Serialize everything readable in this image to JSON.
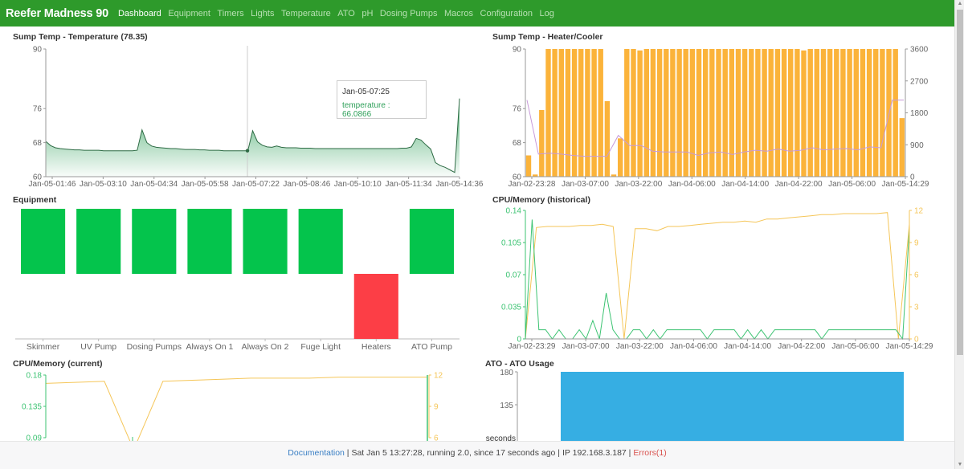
{
  "app": {
    "title": "Reefer Madness 90",
    "nav": [
      {
        "label": "Dashboard",
        "active": true
      },
      {
        "label": "Equipment"
      },
      {
        "label": "Timers"
      },
      {
        "label": "Lights"
      },
      {
        "label": "Temperature"
      },
      {
        "label": "ATO"
      },
      {
        "label": "pH"
      },
      {
        "label": "Dosing Pumps"
      },
      {
        "label": "Macros"
      },
      {
        "label": "Configuration"
      },
      {
        "label": "Log"
      }
    ]
  },
  "colors": {
    "nav_bg": "#2e9a2b",
    "temp_green": "#2fa05a",
    "heater_bar": "#fbb33a",
    "equipment_on": "#04c44c",
    "equipment_off": "#fc3e46",
    "cpu_line": "#3cc372",
    "mem_line": "#f5c659",
    "ato_bar": "#36aee3"
  },
  "panels": {
    "temp": {
      "title": "Sump Temp - Temperature (78.35)"
    },
    "heater": {
      "title": "Sump Temp - Heater/Cooler"
    },
    "equipment": {
      "title": "Equipment"
    },
    "cpu_hist": {
      "title": "CPU/Memory (historical)"
    },
    "cpu_cur": {
      "title": "CPU/Memory (current)"
    },
    "ato": {
      "title": "ATO - ATO Usage"
    }
  },
  "tooltip": {
    "time": "Jan-05-07:25",
    "label": "temperature : 66.0866"
  },
  "footer": {
    "doc_link": "Documentation",
    "sep1": " | ",
    "status": "Sat Jan 5 13:27:28,  running 2.0,  since 17 seconds ago",
    "sep2": " | ",
    "ip": "IP 192.168.3.187",
    "sep3": " | ",
    "errors": "Errors(1)"
  },
  "chart_data": [
    {
      "id": "temp",
      "type": "area",
      "title": "Sump Temp - Temperature (78.35)",
      "ylim": [
        60,
        90
      ],
      "yticks": [
        "60",
        "68",
        "76",
        "90"
      ],
      "xticks": [
        "Jan-05-01:46",
        "Jan-05-03:10",
        "Jan-05-04:34",
        "Jan-05-05:58",
        "Jan-05-07:22",
        "Jan-05-08:46",
        "Jan-05-10:10",
        "Jan-05-11:34",
        "Jan-05-14:36"
      ],
      "series": [
        {
          "name": "temperature",
          "values": [
            68.3,
            67.3,
            66.8,
            66.6,
            66.5,
            66.4,
            66.3,
            66.3,
            66.2,
            66.2,
            66.2,
            66.2,
            66.1,
            66.1,
            66.1,
            66.1,
            66.1,
            66.1,
            66.1,
            66.2,
            71.0,
            68.0,
            67.2,
            66.9,
            66.8,
            66.7,
            66.6,
            66.6,
            66.5,
            66.4,
            66.4,
            66.4,
            66.3,
            66.3,
            66.2,
            66.2,
            66.2,
            66.1,
            66.1,
            66.1,
            66.1,
            66.1,
            66.1,
            70.8,
            68.2,
            67.4,
            67.0,
            66.9,
            67.2,
            66.9,
            66.8,
            66.8,
            66.8,
            66.7,
            66.7,
            66.7,
            66.6,
            66.6,
            66.6,
            66.6,
            66.6,
            66.6,
            66.6,
            66.6,
            66.6,
            66.6,
            66.6,
            66.6,
            66.6,
            66.6,
            66.6,
            66.6,
            66.6,
            66.6,
            66.7,
            66.7,
            67.0,
            69.0,
            68.6,
            67.5,
            66.5,
            63.3,
            62.6,
            62.2,
            61.6,
            61.0,
            78.35
          ]
        }
      ],
      "tooltip": {
        "x": "Jan-05-07:25",
        "value": 66.0866
      }
    },
    {
      "id": "heater",
      "type": "bar",
      "title": "Sump Temp - Heater/Cooler",
      "ylim_left": [
        60,
        90
      ],
      "yticks_left": [
        "60",
        "68",
        "76",
        "90"
      ],
      "ylim_right": [
        0,
        3600
      ],
      "yticks_right": [
        "0",
        "900",
        "1800",
        "2700",
        "3600"
      ],
      "xticks": [
        "Jan-02-23:28",
        "Jan-03-07:00",
        "Jan-03-22:00",
        "Jan-04-06:00",
        "Jan-04-14:00",
        "Jan-04-22:00",
        "Jan-05-06:00",
        "Jan-05-14:29"
      ],
      "bar_values": [
        600,
        60,
        1880,
        3600,
        3600,
        3600,
        3600,
        3600,
        3600,
        3600,
        3600,
        3600,
        2130,
        60,
        1080,
        3600,
        3600,
        3560,
        3600,
        3600,
        3600,
        3600,
        3600,
        3600,
        3600,
        3600,
        3600,
        3600,
        3600,
        3600,
        3600,
        3600,
        3600,
        3600,
        3600,
        3600,
        3600,
        3600,
        3600,
        3600,
        3600,
        3600,
        3560,
        3600,
        3600,
        3600,
        3600,
        3600,
        3600,
        3600,
        3600,
        3600,
        3600,
        3600,
        3600,
        3600,
        3600,
        1650
      ],
      "line_values": [
        78.0,
        65.3,
        65.5,
        65.3,
        65.0,
        64.8,
        64.8,
        64.8,
        69.7,
        67.3,
        67.3,
        66.0,
        65.8,
        65.8,
        65.8,
        65.0,
        65.6,
        65.8,
        65.2,
        65.8,
        66.2,
        66.0,
        66.5,
        66.0,
        66.2,
        66.8,
        66.3,
        66.5,
        66.6,
        66.3,
        67.0,
        66.8,
        78.0,
        78.0
      ]
    },
    {
      "id": "equipment",
      "type": "bar",
      "title": "Equipment",
      "categories": [
        "Skimmer",
        "UV Pump",
        "Dosing Pumps",
        "Always On 1",
        "Always On 2",
        "Fuge Light",
        "Heaters",
        "ATO Pump"
      ],
      "values": [
        1,
        1,
        1,
        1,
        1,
        1,
        -1,
        1
      ],
      "states": [
        "on",
        "on",
        "on",
        "on",
        "on",
        "on",
        "off",
        "on"
      ]
    },
    {
      "id": "cpu_hist",
      "type": "line",
      "title": "CPU/Memory (historical)",
      "ylim_left": [
        0,
        0.14
      ],
      "yticks_left": [
        "0",
        "0.035",
        "0.07",
        "0.105",
        "0.14"
      ],
      "ylim_right": [
        0,
        12
      ],
      "yticks_right": [
        "0",
        "3",
        "6",
        "9",
        "12"
      ],
      "xticks": [
        "Jan-02-23:29",
        "Jan-03-07:00",
        "Jan-03-22:00",
        "Jan-04-06:00",
        "Jan-04-14:00",
        "Jan-04-22:00",
        "Jan-05-06:00",
        "Jan-05-14:29"
      ],
      "series": [
        {
          "name": "cpu",
          "axis": "left",
          "values": [
            0,
            0.13,
            0.01,
            0.01,
            0,
            0.01,
            0,
            0,
            0.01,
            0,
            0.02,
            0,
            0.05,
            0.01,
            0,
            0,
            0.01,
            0.01,
            0,
            0.01,
            0,
            0.01,
            0.01,
            0.01,
            0.01,
            0.01,
            0.01,
            0,
            0.01,
            0.01,
            0.01,
            0.01,
            0,
            0.01,
            0,
            0.01,
            0,
            0.01,
            0.01,
            0.01,
            0.01,
            0.01,
            0.01,
            0.01,
            0,
            0.01,
            0.01,
            0.01,
            0.01,
            0.01,
            0.01,
            0.01,
            0.01,
            0.01,
            0.01,
            0.01,
            0,
            0.12
          ]
        },
        {
          "name": "memory",
          "axis": "right",
          "values": [
            0,
            10.4,
            10.5,
            10.5,
            10.5,
            10.6,
            10.6,
            10.7,
            10.5,
            0,
            10.3,
            10.3,
            10.1,
            10.5,
            10.5,
            10.6,
            10.7,
            10.8,
            10.9,
            10.9,
            11.0,
            10.9,
            11.2,
            11.2,
            11.3,
            11.4,
            11.5,
            11.6,
            11.6,
            11.7,
            11.7,
            11.7,
            11.7,
            11.8,
            0,
            10.7
          ]
        }
      ]
    },
    {
      "id": "cpu_cur",
      "type": "line",
      "title": "CPU/Memory (current)",
      "ylim_left": [
        0,
        0.18
      ],
      "yticks_left": [
        "0.09",
        "0.135",
        "0.18"
      ],
      "ylim_right": [
        0,
        12
      ],
      "yticks_right": [
        "6",
        "9",
        "12"
      ],
      "series": [
        {
          "name": "cpu",
          "axis": "left",
          "values": [
            0.045,
            0.045,
            0.045,
            0.045,
            0.095,
            0.045,
            0.045,
            0.045,
            0.045,
            0.045,
            0.045,
            0.045,
            0.045,
            0.18
          ]
        },
        {
          "name": "memory",
          "axis": "right",
          "values": [
            11.2,
            11.3,
            11.4,
            0,
            11.4,
            11.5,
            11.6,
            11.7,
            11.7,
            11.7,
            11.8,
            11.8,
            11.8,
            11.8
          ]
        }
      ]
    },
    {
      "id": "ato",
      "type": "bar",
      "title": "ATO - ATO Usage",
      "ylabel": "seconds",
      "yticks": [
        "135",
        "180"
      ],
      "ylim": [
        90,
        180
      ],
      "values": [
        180
      ]
    }
  ]
}
